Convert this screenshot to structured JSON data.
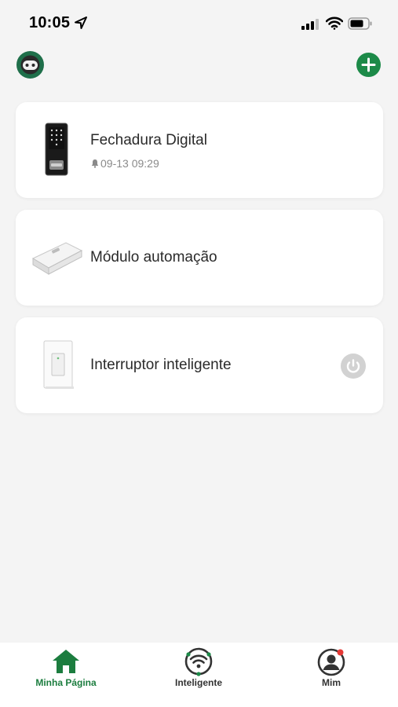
{
  "status_bar": {
    "time": "10:05"
  },
  "colors": {
    "accent": "#1c8a48",
    "tab_active": "#1c7d3f",
    "inactive": "#333333"
  },
  "devices": [
    {
      "name": "Fechadura Digital",
      "subtitle": "09-13 09:29",
      "icon": "smart-lock"
    },
    {
      "name": "Módulo automação",
      "icon": "relay-module"
    },
    {
      "name": "Interruptor inteligente",
      "icon": "wall-switch",
      "action_icon": "power-icon"
    }
  ],
  "tabs": [
    {
      "label": "Minha Página",
      "icon": "home-icon",
      "active": true
    },
    {
      "label": "Inteligente",
      "icon": "smart-scene-icon",
      "active": false
    },
    {
      "label": "Mim",
      "icon": "profile-icon",
      "active": false
    }
  ]
}
